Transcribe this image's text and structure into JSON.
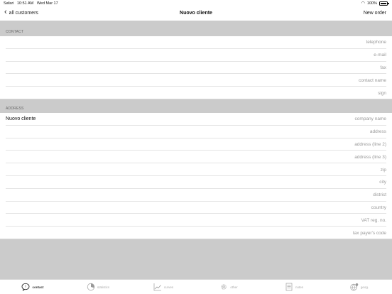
{
  "status_bar": {
    "app": "Safari",
    "time": "10:51 AM",
    "date": "Wed Mar 17",
    "battery": "100%"
  },
  "nav": {
    "back_label": "all customers",
    "title": "Nuovo cliente",
    "right_label": "New order"
  },
  "contact": {
    "header": "CONTACT",
    "fields": [
      {
        "value": "",
        "placeholder": "telephone"
      },
      {
        "value": "",
        "placeholder": "e-mail"
      },
      {
        "value": "",
        "placeholder": "fax"
      },
      {
        "value": "",
        "placeholder": "contact name"
      },
      {
        "value": "",
        "placeholder": "sign"
      }
    ]
  },
  "address": {
    "header": "ADDRESS",
    "fields": [
      {
        "value": "Nuovo cliente",
        "placeholder": "company name"
      },
      {
        "value": "",
        "placeholder": "address"
      },
      {
        "value": "",
        "placeholder": "address (line 2)"
      },
      {
        "value": "",
        "placeholder": "address (line 3)"
      },
      {
        "value": "",
        "placeholder": "zip"
      },
      {
        "value": "",
        "placeholder": "city"
      },
      {
        "value": "",
        "placeholder": "district"
      },
      {
        "value": "",
        "placeholder": "country"
      },
      {
        "value": "",
        "placeholder": "VAT reg. no."
      },
      {
        "value": "",
        "placeholder": "tax payer's code"
      }
    ]
  },
  "tabs": [
    {
      "label": "contact",
      "icon": "speech-bubble-icon",
      "active": true
    },
    {
      "label": "statistics",
      "icon": "pie-chart-icon",
      "active": false
    },
    {
      "label": "curves",
      "icon": "line-chart-icon",
      "active": false
    },
    {
      "label": "other",
      "icon": "gear-icon",
      "active": false
    },
    {
      "label": "notes",
      "icon": "notes-icon",
      "active": false
    },
    {
      "label": "geog.",
      "icon": "globe-pin-icon",
      "active": false
    }
  ]
}
